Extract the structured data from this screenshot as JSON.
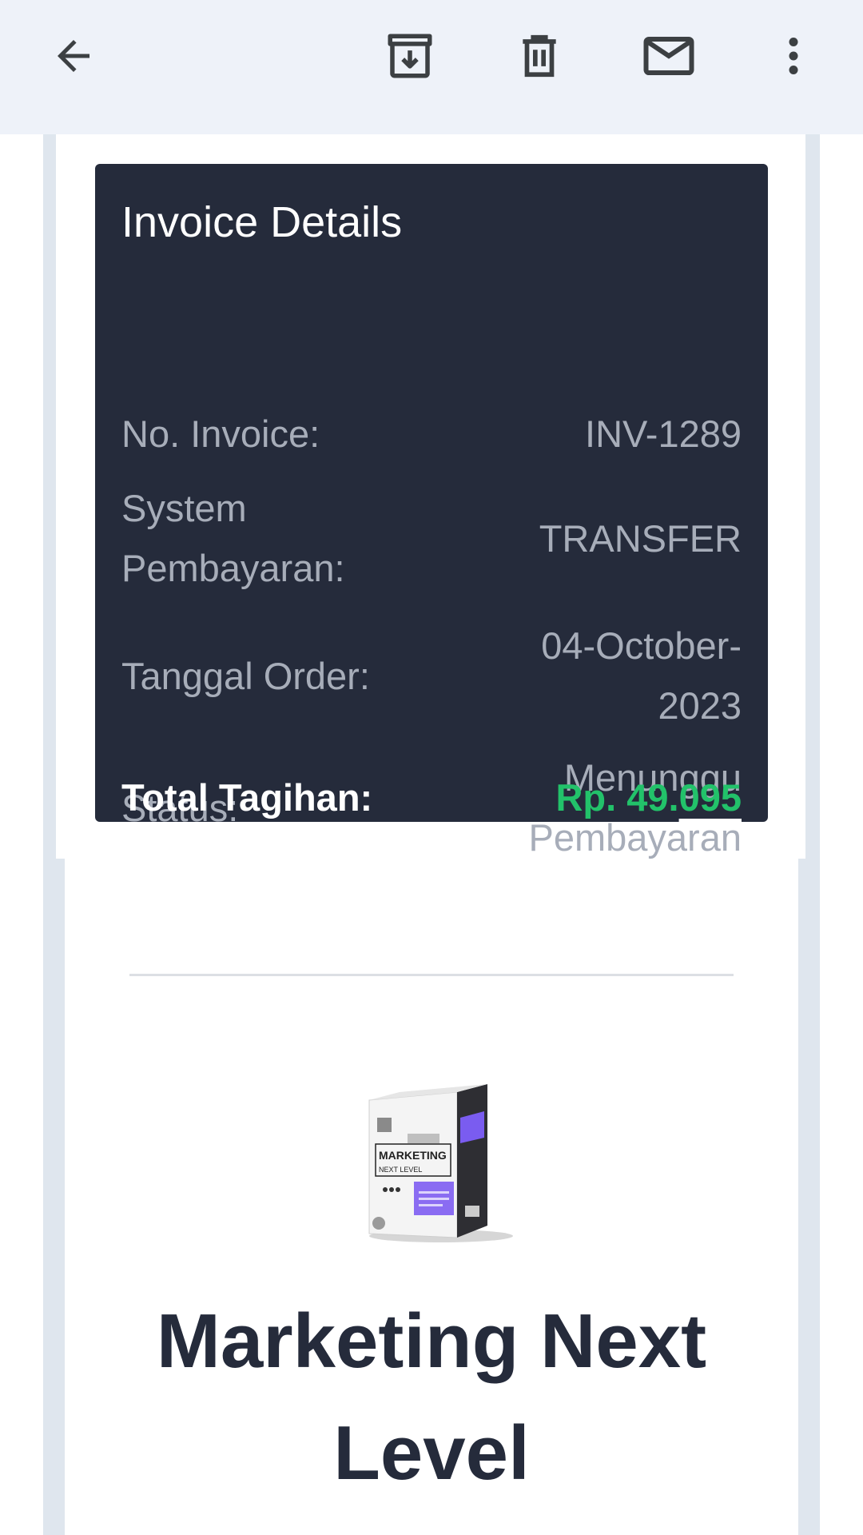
{
  "toolbar": {
    "back_icon": "arrow-left-icon",
    "archive_icon": "archive-download-icon",
    "delete_icon": "trash-icon",
    "mark_unread_icon": "mail-icon",
    "more_icon": "more-vertical-icon"
  },
  "invoice": {
    "title": "Invoice Details",
    "rows": [
      {
        "label": "No. Invoice:",
        "value": "INV-1289"
      },
      {
        "label": "System Pembayaran:",
        "value": "TRANSFER"
      },
      {
        "label": "Tanggal Order:",
        "value": "04-October-2023"
      },
      {
        "label": "Status:",
        "value": "Menunggu Pembayaran"
      }
    ],
    "total": {
      "label": "Total Tagihan:",
      "value_prefix": "Rp. 49.",
      "value_suffix": "095"
    }
  },
  "product": {
    "box_text_main": "MARKETING",
    "box_text_sub": "NEXT LEVEL",
    "title": "Marketing Next Level"
  },
  "colors": {
    "appbar_bg": "#eef2f9",
    "card_bg": "#252b3b",
    "total_green": "#22c26a"
  }
}
